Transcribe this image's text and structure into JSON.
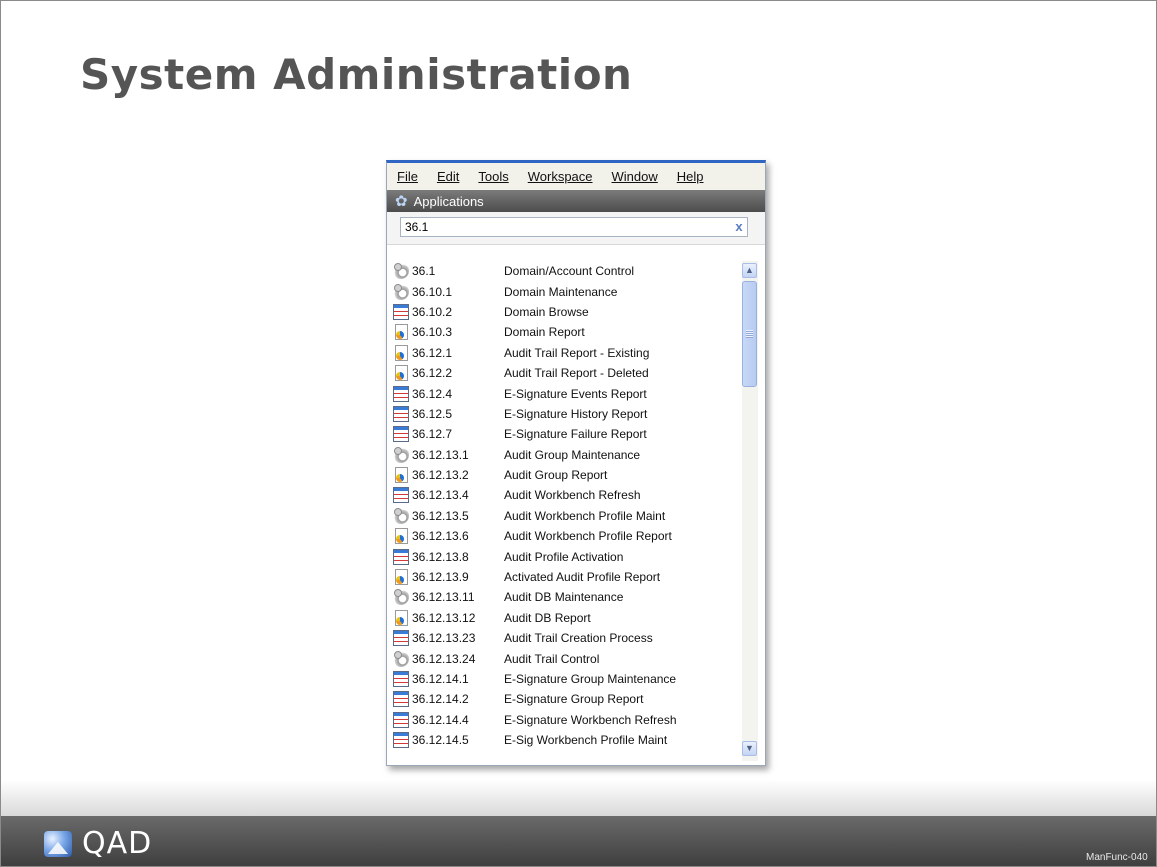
{
  "slide": {
    "title": "System Administration",
    "footer_logo": "QAD",
    "code": "ManFunc-040"
  },
  "window": {
    "menu": [
      "File",
      "Edit",
      "Tools",
      "Workspace",
      "Window",
      "Help"
    ],
    "panel_title": "Applications",
    "panel_icon": "gear-icon",
    "search": {
      "value": "36.1",
      "clear_icon": "x"
    }
  },
  "list": {
    "items": [
      {
        "code": "36.1",
        "label": "Domain/Account Control",
        "icon": "gear"
      },
      {
        "code": "36.10.1",
        "label": "Domain Maintenance",
        "icon": "gear"
      },
      {
        "code": "36.10.2",
        "label": "Domain Browse",
        "icon": "browse"
      },
      {
        "code": "36.10.3",
        "label": "Domain Report",
        "icon": "report"
      },
      {
        "code": "36.12.1",
        "label": "Audit Trail Report - Existing",
        "icon": "report"
      },
      {
        "code": "36.12.2",
        "label": "Audit Trail Report - Deleted",
        "icon": "report"
      },
      {
        "code": "36.12.4",
        "label": "E-Signature Events Report",
        "icon": "browse"
      },
      {
        "code": "36.12.5",
        "label": "E-Signature History Report",
        "icon": "browse"
      },
      {
        "code": "36.12.7",
        "label": "E-Signature Failure Report",
        "icon": "browse"
      },
      {
        "code": "36.12.13.1",
        "label": "Audit Group Maintenance",
        "icon": "gear"
      },
      {
        "code": "36.12.13.2",
        "label": "Audit Group Report",
        "icon": "report"
      },
      {
        "code": "36.12.13.4",
        "label": "Audit Workbench Refresh",
        "icon": "browse"
      },
      {
        "code": "36.12.13.5",
        "label": "Audit Workbench Profile Maint",
        "icon": "gear"
      },
      {
        "code": "36.12.13.6",
        "label": "Audit Workbench Profile Report",
        "icon": "report"
      },
      {
        "code": "36.12.13.8",
        "label": "Audit Profile Activation",
        "icon": "browse"
      },
      {
        "code": "36.12.13.9",
        "label": "Activated Audit Profile Report",
        "icon": "report"
      },
      {
        "code": "36.12.13.11",
        "label": "Audit DB Maintenance",
        "icon": "gear"
      },
      {
        "code": "36.12.13.12",
        "label": "Audit DB Report",
        "icon": "report"
      },
      {
        "code": "36.12.13.23",
        "label": "Audit Trail Creation Process",
        "icon": "browse"
      },
      {
        "code": "36.12.13.24",
        "label": "Audit Trail Control",
        "icon": "gear"
      },
      {
        "code": "36.12.14.1",
        "label": "E-Signature Group Maintenance",
        "icon": "browse"
      },
      {
        "code": "36.12.14.2",
        "label": "E-Signature Group Report",
        "icon": "browse"
      },
      {
        "code": "36.12.14.4",
        "label": "E-Signature Workbench Refresh",
        "icon": "browse"
      },
      {
        "code": "36.12.14.5",
        "label": "E-Sig Workbench Profile Maint",
        "icon": "browse"
      }
    ]
  },
  "colors": {
    "title": "#555555",
    "window_accent": "#2f66c3",
    "footer": "#4a4a4a"
  }
}
